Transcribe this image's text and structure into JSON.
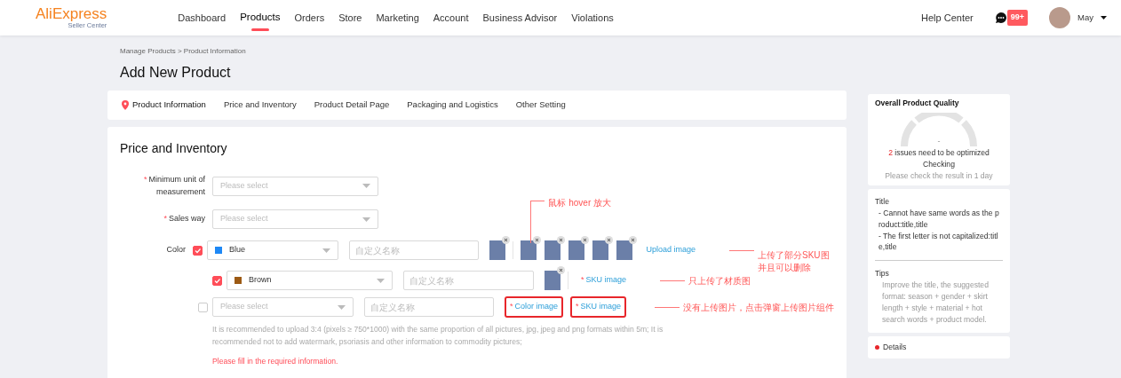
{
  "header": {
    "logo": "AliExpress",
    "logo_sub": "Seller Center",
    "nav": [
      {
        "label": "Dashboard",
        "selected": false
      },
      {
        "label": "Products",
        "selected": true
      },
      {
        "label": "Orders",
        "selected": false
      },
      {
        "label": "Store",
        "selected": false
      },
      {
        "label": "Marketing",
        "selected": false
      },
      {
        "label": "Account",
        "selected": false
      },
      {
        "label": "Business Advisor",
        "selected": false
      },
      {
        "label": "Violations",
        "selected": false
      }
    ],
    "help": "Help Center",
    "message_count": "99+",
    "user": "May"
  },
  "breadcrumb": "Manage Products > Product Information",
  "page_title": "Add New Product",
  "section_tabs": [
    {
      "label": "Product Information",
      "selected": true
    },
    {
      "label": "Price and Inventory",
      "selected": false
    },
    {
      "label": "Product Detail Page",
      "selected": false
    },
    {
      "label": "Packaging and Logistics",
      "selected": false
    },
    {
      "label": "Other Setting",
      "selected": false
    }
  ],
  "section": {
    "title": "Price and Inventory",
    "required_mark": "*",
    "fields": [
      {
        "label": "Minimum unit of measurement",
        "required": true,
        "placeholder": "Please select"
      },
      {
        "label": "Sales way",
        "required": true,
        "placeholder": "Please select"
      }
    ],
    "color": {
      "label": "Color",
      "rows": [
        {
          "checked": true,
          "value": "Blue",
          "color": "#1e88f5",
          "name_placeholder": "自定义名称",
          "color_image": {
            "kind": "photo",
            "removable": true
          },
          "sku_images": [
            {
              "kind": "photo",
              "removable": true
            },
            {
              "kind": "photo",
              "removable": true
            },
            {
              "kind": "photo",
              "removable": true
            },
            {
              "kind": "photo",
              "removable": true
            },
            {
              "kind": "photo",
              "removable": true
            }
          ],
          "link": {
            "label": "Upload image",
            "required": false,
            "outlined": false
          },
          "hover_note": "鼠标 hover 放大",
          "note": "上传了部分SKU图并且可以删除"
        },
        {
          "checked": true,
          "value": "Brown",
          "color": "#9c5a14",
          "name_placeholder": "自定义名称",
          "color_image": {
            "kind": "photo",
            "removable": true
          },
          "link": {
            "label": "SKU image",
            "required": true,
            "outlined": false
          },
          "note": "只上传了材质图"
        },
        {
          "checked": false,
          "placeholder": "Please select",
          "name_placeholder": "自定义名称",
          "color_image": {
            "kind": "link",
            "label": "Color image",
            "required": true,
            "outlined": true
          },
          "link": {
            "label": "SKU image",
            "required": true,
            "outlined": true
          },
          "note": "没有上传图片，点击弹窗上传图片组件"
        }
      ],
      "hint": "It is recommended to upload 3:4 (pixels ≥ 750*1000) with the same proportion of all pictures, jpg, jpeg and png formats within 5m; It is recommended not to add watermark, psoriasis and other information to commodity pictures;",
      "error": "Please fill in the required information."
    }
  },
  "quality": {
    "title": "Overall Product Quality",
    "score": "-",
    "issues_count": "2",
    "issues_text": "issues need to be optimized",
    "status": "Checking",
    "hint": "Please check the result in 1 day"
  },
  "advice": {
    "heading": "Title",
    "items": [
      "- Cannot have same words as the product:title,title",
      "- The first letter is not capitalized:title,title"
    ],
    "tips_heading": "Tips",
    "tips": "Improve the title, the suggested format: season + gender + skirt length + style + material + hot search words + product model."
  },
  "details": {
    "label": "Details"
  }
}
